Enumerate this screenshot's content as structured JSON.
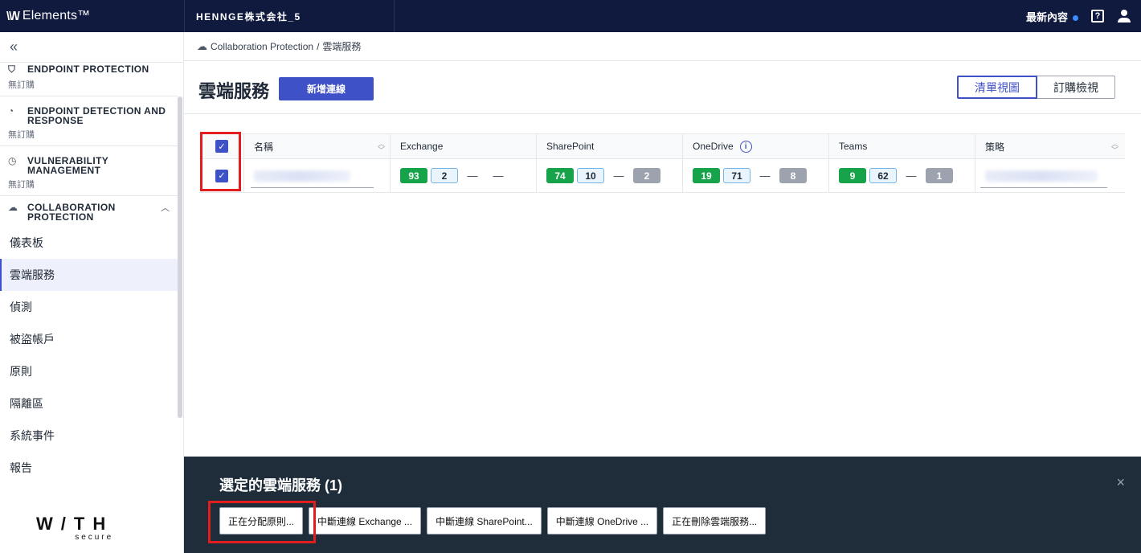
{
  "topbar": {
    "brand_mark": "\\\\/\\/",
    "brand_name": "Elements™",
    "org": "HENNGE株式会社_5",
    "news_label": "最新內容",
    "help_glyph": "?"
  },
  "sidebar": {
    "collapse_glyph": "«",
    "sections": [
      {
        "title": "ENDPOINT PROTECTION",
        "sub": "無訂購"
      },
      {
        "title": "ENDPOINT DETECTION AND RESPONSE",
        "sub": "無訂購"
      },
      {
        "title": "VULNERABILITY MANAGEMENT",
        "sub": "無訂購"
      },
      {
        "title": "COLLABORATION PROTECTION",
        "sub": ""
      }
    ],
    "items": [
      "儀表板",
      "雲端服務",
      "偵測",
      "被盜帳戶",
      "原則",
      "隔離區",
      "系統事件",
      "報告"
    ],
    "logo_big": "W/TH",
    "logo_small": "secure"
  },
  "breadcrumb": {
    "root": "Collaboration Protection",
    "sep": "/",
    "current": "雲端服務"
  },
  "page": {
    "title": "雲端服務",
    "add_button": "新增連線",
    "view_list": "清單視圖",
    "view_subscription": "訂購檢視"
  },
  "table": {
    "headers": {
      "name": "名稱",
      "exchange": "Exchange",
      "sharepoint": "SharePoint",
      "onedrive": "OneDrive",
      "teams": "Teams",
      "policy": "策略"
    },
    "row": {
      "exchange": {
        "green": "93",
        "blue": "2",
        "d1": "—",
        "d2": "—"
      },
      "sharepoint": {
        "green": "74",
        "blue": "10",
        "d1": "—",
        "grey": "2"
      },
      "onedrive": {
        "green": "19",
        "blue": "71",
        "d1": "—",
        "grey": "8"
      },
      "teams": {
        "green": "9",
        "blue": "62",
        "d1": "—",
        "grey": "1"
      }
    }
  },
  "actionbar": {
    "title": "選定的雲端服務 (1)",
    "close": "×",
    "buttons": [
      "正在分配原則...",
      "中斷連線 Exchange ...",
      "中斷連線 SharePoint...",
      "中斷連線 OneDrive ...",
      "正在刪除雲端服務..."
    ]
  },
  "colors": {
    "accent": "#3f51c7",
    "topbar": "#101a3f",
    "highlight": "#e11d1d",
    "green": "#16a34a"
  }
}
